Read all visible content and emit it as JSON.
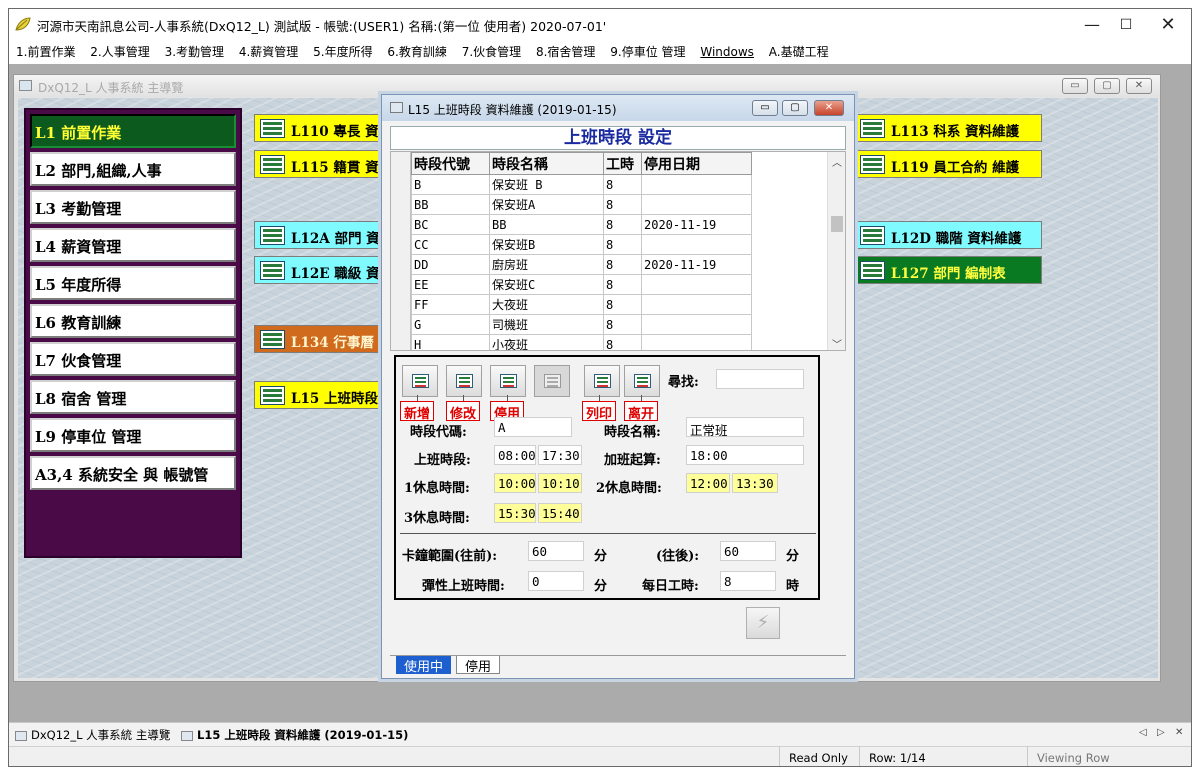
{
  "app": {
    "title": "河源市天南訊息公司-人事系統(DxQ12_L) 測試版 - 帳號:(USER1) 名稱:(第一位 使用者) 2020-07-01'",
    "menu": [
      "1.前置作業",
      "2.人事管理",
      "3.考勤管理",
      "4.薪資管理",
      "5.年度所得",
      "6.教育訓練",
      "7.伙食管理",
      "8.宿舍管理",
      "9.停車位 管理",
      "Windows",
      "A.基礎工程"
    ]
  },
  "main_window": {
    "title": "DxQ12_L 人事系統 主導覽"
  },
  "left_nav": [
    "L1 前置作業",
    "L2 部門,組織,人事",
    "L3 考勤管理",
    "L4 薪資管理",
    "L5 年度所得",
    "L6 教育訓練",
    "L7 伙食管理",
    "L8 宿舍 管理",
    "L9 停車位 管理",
    "A3,4 系統安全 與 帳號管"
  ],
  "tiles": {
    "l110": "L110 專長 資",
    "l115": "L115 籍貫 資",
    "l12a": "L12A 部門 資",
    "l12e": "L12E 職級 資",
    "l134": "L134 行事曆",
    "l15": "L15 上班時段",
    "l113": "L113 科系 資料維護",
    "l119": "L119 員工合約 維護",
    "l12d": "L12D 職階 資料維護",
    "l127": "L127 部門 編制表"
  },
  "dialog": {
    "title": "L15 上班時段 資料維護 (2019-01-15)",
    "heading": "上班時段 設定",
    "grid": {
      "columns": [
        "時段代號",
        "時段名稱",
        "工時",
        "停用日期"
      ],
      "rows": [
        [
          "B",
          "保安班 B",
          "8",
          ""
        ],
        [
          "BB",
          "保安班A",
          "8",
          ""
        ],
        [
          "BC",
          "BB",
          "8",
          "2020-11-19"
        ],
        [
          "CC",
          "保安班B",
          "8",
          ""
        ],
        [
          "DD",
          "廚房班",
          "8",
          "2020-11-19"
        ],
        [
          "EE",
          "保安班C",
          "8",
          ""
        ],
        [
          "FF",
          "大夜班",
          "8",
          ""
        ],
        [
          "G",
          "司機班",
          "8",
          ""
        ],
        [
          "H",
          "小夜班",
          "8",
          ""
        ]
      ]
    },
    "toolbar": {
      "add": "新增",
      "edit": "修改",
      "disable": "停用",
      "print": "列印",
      "exit": "离开",
      "search_label": "尋找:",
      "search_value": ""
    },
    "form": {
      "code_label": "時段代碼:",
      "code_value": "A",
      "name_label": "時段名稱:",
      "name_value": "正常班",
      "work_label": "上班時段:",
      "work_start": "08:00",
      "work_end": "17:30",
      "ot_label": "加班起算:",
      "ot_value": "18:00",
      "rest1_label": "1休息時間:",
      "rest1_start": "10:00",
      "rest1_end": "10:10",
      "rest2_label": "2休息時間:",
      "rest2_start": "12:00",
      "rest2_end": "13:30",
      "rest3_label": "3休息時間:",
      "rest3_start": "15:30",
      "rest3_end": "15:40",
      "clock_before_label": "卡鐘範圍(往前):",
      "clock_before_value": "60",
      "unit_min": "分",
      "clock_after_label": "(往後):",
      "clock_after_value": "60",
      "flex_label": "彈性上班時間:",
      "flex_value": "0",
      "daily_label": "每日工時:",
      "daily_value": "8",
      "unit_hour": "時"
    },
    "tabs": [
      "使用中",
      "停用"
    ]
  },
  "taskbar": {
    "items": [
      "DxQ12_L 人事系統 主導覽",
      "L15 上班時段 資料維護 (2019-01-15)"
    ]
  },
  "status": {
    "mode": "Read Only",
    "row": "Row: 1/14",
    "view": "Viewing Row"
  },
  "colors": {
    "nav_bg": "#4a0a47",
    "nav_active": "#0d5a1f",
    "tile_yellow": "#ffff00",
    "tile_cyan": "#7ffbff",
    "tile_orange": "#d06a1c",
    "tile_green": "#0a7a22",
    "callout_red": "#e00000",
    "heading_blue": "#1a2aa0"
  }
}
